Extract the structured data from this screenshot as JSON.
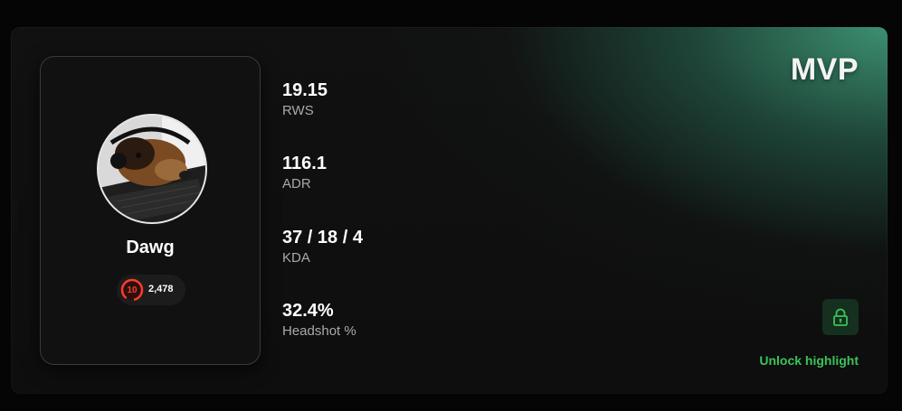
{
  "player": {
    "name": "Dawg",
    "avatar_description": "dog-photo-avatar",
    "skill_level": "10",
    "elo": "2,478"
  },
  "badge": {
    "label": "MVP"
  },
  "stats": [
    {
      "value": "19.15",
      "label": "RWS"
    },
    {
      "value": "116.1",
      "label": "ADR"
    },
    {
      "value": "37 / 18 / 4",
      "label": "KDA"
    },
    {
      "value": "32.4%",
      "label": "Headshot %"
    }
  ],
  "highlight": {
    "lock_icon": "lock-icon",
    "unlock_label": "Unlock highlight"
  },
  "colors": {
    "accent_green": "#3cc25b",
    "gradient_teal": "#3e9676",
    "skill_red": "#ff3a2b",
    "card_bg": "#111111"
  }
}
